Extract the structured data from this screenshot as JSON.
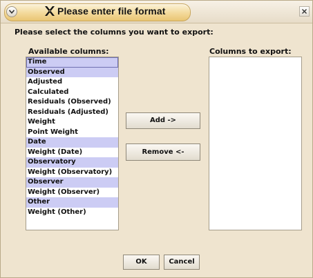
{
  "window": {
    "title": "Please enter file format"
  },
  "prompt": "Please select the columns you want to export:",
  "available": {
    "label": "Available columns:",
    "items": [
      {
        "label": "Time",
        "group": true
      },
      {
        "label": "Observed",
        "group": true
      },
      {
        "label": "Adjusted",
        "group": false
      },
      {
        "label": "Calculated",
        "group": false
      },
      {
        "label": "Residuals (Observed)",
        "group": false
      },
      {
        "label": "Residuals (Adjusted)",
        "group": false
      },
      {
        "label": "Weight",
        "group": false
      },
      {
        "label": "Point Weight",
        "group": false
      },
      {
        "label": "Date",
        "group": true
      },
      {
        "label": "Weight (Date)",
        "group": false
      },
      {
        "label": "Observatory",
        "group": true
      },
      {
        "label": "Weight (Observatory)",
        "group": false
      },
      {
        "label": "Observer",
        "group": true
      },
      {
        "label": "Weight (Observer)",
        "group": false
      },
      {
        "label": "Other",
        "group": true
      },
      {
        "label": "Weight (Other)",
        "group": false
      }
    ]
  },
  "export": {
    "label": "Columns to export:",
    "items": []
  },
  "buttons": {
    "add": "Add ->",
    "remove": "Remove <-",
    "ok": "OK",
    "cancel": "Cancel"
  },
  "colors": {
    "group_highlight": "#ccccf4",
    "title_pill": "#f3d99a"
  }
}
